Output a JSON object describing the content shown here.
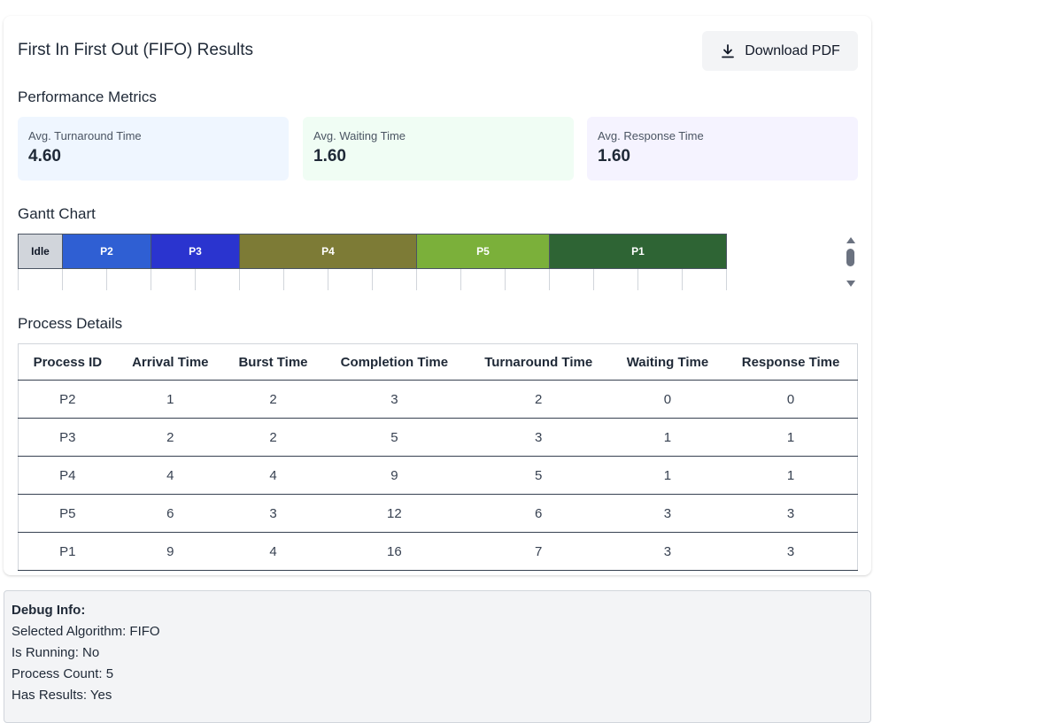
{
  "results": {
    "title": "First In First Out (FIFO) Results",
    "download_label": "Download PDF"
  },
  "metrics": {
    "heading": "Performance Metrics",
    "items": [
      {
        "label": "Avg. Turnaround Time",
        "value": "4.60",
        "bg": "#eff6ff"
      },
      {
        "label": "Avg. Waiting Time",
        "value": "1.60",
        "bg": "#f0fdf4"
      },
      {
        "label": "Avg. Response Time",
        "value": "1.60",
        "bg": "#f5f3ff"
      }
    ]
  },
  "gantt": {
    "heading": "Gantt Chart",
    "time_end": 16,
    "blocks": [
      {
        "label": "Idle",
        "start": 0,
        "end": 1,
        "color": "#d1d5db",
        "text_color": "#111827"
      },
      {
        "label": "P2",
        "start": 1,
        "end": 3,
        "color": "#2f5fd3",
        "text_color": "#ffffff"
      },
      {
        "label": "P3",
        "start": 3,
        "end": 5,
        "color": "#2a34cf",
        "text_color": "#ffffff"
      },
      {
        "label": "P4",
        "start": 5,
        "end": 9,
        "color": "#7d7b36",
        "text_color": "#ffffff"
      },
      {
        "label": "P5",
        "start": 9,
        "end": 12,
        "color": "#7bb03a",
        "text_color": "#ffffff"
      },
      {
        "label": "P1",
        "start": 12,
        "end": 16,
        "color": "#2e6434",
        "text_color": "#ffffff"
      }
    ]
  },
  "process_details": {
    "heading": "Process Details",
    "columns": [
      "Process ID",
      "Arrival Time",
      "Burst Time",
      "Completion Time",
      "Turnaround Time",
      "Waiting Time",
      "Response Time"
    ],
    "rows": [
      [
        "P2",
        "1",
        "2",
        "3",
        "2",
        "0",
        "0"
      ],
      [
        "P3",
        "2",
        "2",
        "5",
        "3",
        "1",
        "1"
      ],
      [
        "P4",
        "4",
        "4",
        "9",
        "5",
        "1",
        "1"
      ],
      [
        "P5",
        "6",
        "3",
        "12",
        "6",
        "3",
        "3"
      ],
      [
        "P1",
        "9",
        "4",
        "16",
        "7",
        "3",
        "3"
      ]
    ]
  },
  "debug": {
    "heading": "Debug Info:",
    "lines": [
      "Selected Algorithm: FIFO",
      "Is Running: No",
      "Process Count: 5",
      "Has Results: Yes"
    ]
  }
}
